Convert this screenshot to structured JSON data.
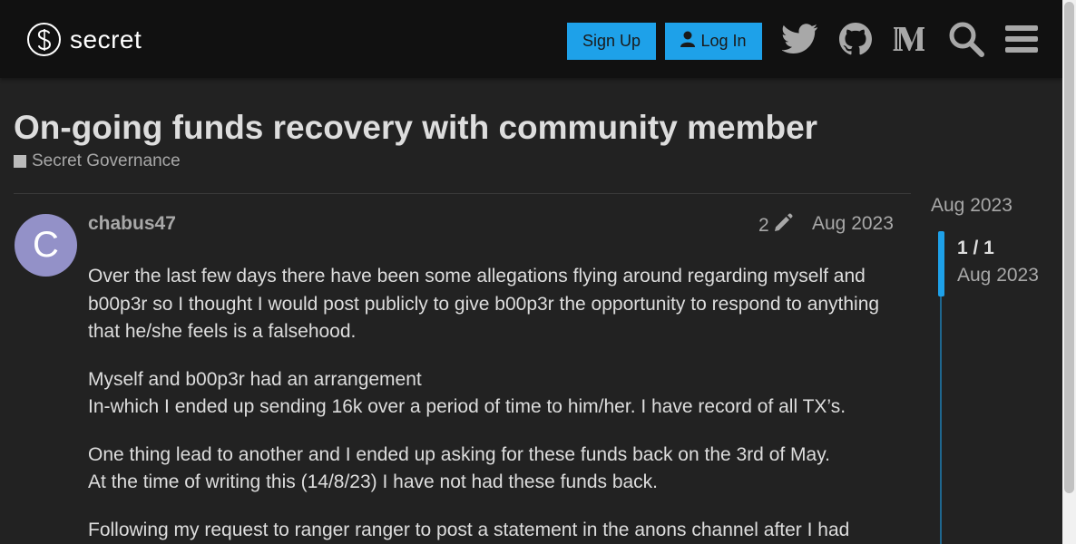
{
  "header": {
    "logo_text": "secret",
    "signup_label": "Sign Up",
    "login_label": "Log In",
    "icons": [
      "twitter-icon",
      "github-icon",
      "medium-icon",
      "search-icon",
      "hamburger-menu-icon"
    ],
    "accent_color": "#1ea1e9"
  },
  "topic": {
    "title": "On-going funds recovery with community member",
    "category": "Secret Governance",
    "category_color": "#bbbbbb"
  },
  "post": {
    "avatar_letter": "C",
    "avatar_color": "#9391c8",
    "username": "chabus47",
    "edit_count": "2",
    "date": "Aug 2023",
    "paragraphs": [
      [
        "Over the last few days there have been some allegations flying around regarding myself and b00p3r so I thought I would post publicly to give b00p3r the opportunity to respond to anything that he/she feels is a falsehood."
      ],
      [
        "Myself and b00p3r had an arrangement",
        "In-which I ended up sending 16k over a period of time to him/her. I have record of all TX’s."
      ],
      [
        "One thing lead to another and I ended up asking for these funds back on the 3rd of May.",
        "At the time of writing this (14/8/23) I have not had these funds back."
      ],
      [
        "Following my request to ranger ranger to post a statement in the anons channel after I had"
      ]
    ]
  },
  "timeline": {
    "top_date": "Aug 2023",
    "count": "1 / 1",
    "date": "Aug 2023"
  }
}
